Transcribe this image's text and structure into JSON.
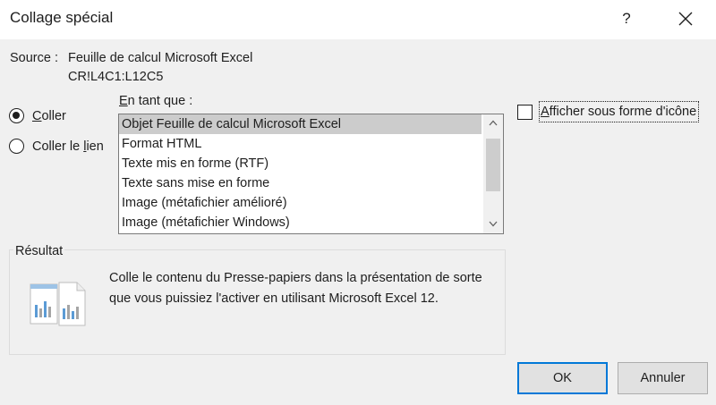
{
  "window": {
    "title": "Collage spécial",
    "help_label": "?",
    "icons": {
      "close": "close-icon"
    }
  },
  "source": {
    "label": "Source :",
    "name": "Feuille de calcul Microsoft Excel",
    "range": "CR!L4C1:L12C5"
  },
  "paste_options": {
    "paste": {
      "label": "Coller",
      "selected": true
    },
    "paste_link": {
      "label": "Coller le lien",
      "selected": false
    }
  },
  "as": {
    "label": "En tant que :",
    "items": [
      "Objet Feuille de calcul Microsoft Excel",
      "Format HTML",
      "Texte mis en forme (RTF)",
      "Texte sans mise en forme",
      "Image (métafichier amélioré)",
      "Image (métafichier Windows)"
    ],
    "selected_index": 0
  },
  "display_as_icon": {
    "label": "Afficher sous forme d'icône",
    "checked": false
  },
  "result": {
    "legend": "Résultat",
    "line1": "Colle le contenu du Presse-papiers dans la présentation de sorte",
    "line2": "que vous puissiez l'activer en utilisant Microsoft Excel 12."
  },
  "buttons": {
    "ok": "OK",
    "cancel": "Annuler"
  },
  "colors": {
    "accent": "#0078d7",
    "selection": "#cccccc",
    "background": "#f0f0f0"
  }
}
